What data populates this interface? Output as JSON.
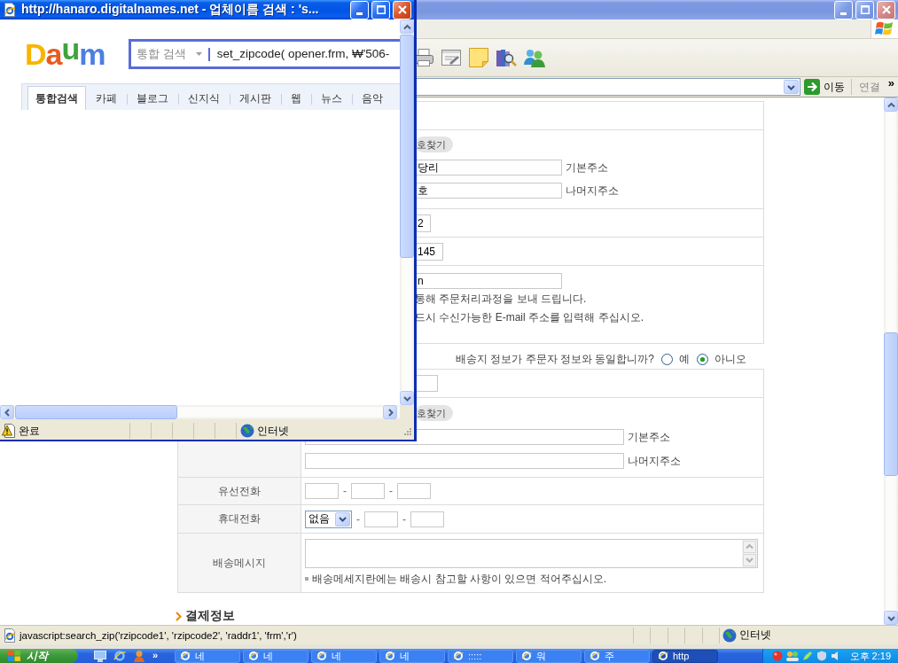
{
  "browser_window": {
    "active": false,
    "address_bar": {
      "go_button": "이동",
      "links": "연결",
      "more": "»"
    },
    "orderer_form": {
      "zip_button": "호찾기",
      "address_fields": [
        {
          "value": "당리",
          "label": "기본주소"
        },
        {
          "value": "호",
          "label": "나머지주소"
        }
      ],
      "phone_value": "2",
      "mobile_value": "145",
      "email_value": "n",
      "email_notes": [
        "통해 주문처리과정을 보내 드립니다.",
        "드시 수신가능한 E-mail 주소를 입력해 주십시오."
      ]
    },
    "same_as_orderer": {
      "question": "배송지 정보가 주문자 정보와 동일합니까?",
      "options": [
        {
          "label": "예",
          "selected": false
        },
        {
          "label": "아니오",
          "selected": true
        }
      ]
    },
    "delivery_form": {
      "zip_button": "호찾기",
      "address_fields": [
        {
          "label": "기본주소"
        },
        {
          "label": "나머지주소"
        }
      ],
      "rows": [
        {
          "label": "유선전화",
          "parts": [
            {
              "kind": "field"
            },
            {
              "kind": "dash",
              "text": "-"
            },
            {
              "kind": "field"
            },
            {
              "kind": "dash",
              "text": "-"
            },
            {
              "kind": "field"
            }
          ]
        },
        {
          "label": "휴대전화",
          "parts": [
            {
              "kind": "select",
              "value": "없음"
            },
            {
              "kind": "dash",
              "text": "-"
            },
            {
              "kind": "field"
            },
            {
              "kind": "dash",
              "text": "-"
            },
            {
              "kind": "field"
            }
          ]
        },
        {
          "label": "배송메시지",
          "parts": [
            {
              "kind": "textarea"
            },
            {
              "kind": "note",
              "text": "배송메세지란에는 배송시 참고할 사항이 있으면 적어주십시오."
            }
          ]
        }
      ]
    },
    "payment_heading": "결제정보",
    "status_bar": {
      "text": "javascript:search_zip('rzipcode1', 'rzipcode2', 'raddr1', 'frm','r')",
      "zone": "인터넷"
    }
  },
  "popup_window": {
    "active": true,
    "title": "http://hanaro.digitalnames.net - 업체이름 검색 : 's...",
    "logo": "Daum",
    "search": {
      "scope": "통합 검색",
      "value": "set_zipcode( opener.frm, ₩'506-"
    },
    "tabs": [
      {
        "label": "통합검색",
        "selected": true
      },
      {
        "label": "카페",
        "selected": false
      },
      {
        "label": "블로그",
        "selected": false
      },
      {
        "label": "신지식",
        "selected": false
      },
      {
        "label": "게시판",
        "selected": false
      },
      {
        "label": "웹",
        "selected": false
      },
      {
        "label": "뉴스",
        "selected": false
      },
      {
        "label": "음악",
        "selected": false
      }
    ],
    "status_bar": {
      "status": "완료",
      "zone": "인터넷"
    }
  },
  "taskbar": {
    "start": "시작",
    "more": "»",
    "tasks": [
      {
        "label": "네",
        "selected": false
      },
      {
        "label": "네",
        "selected": false
      },
      {
        "label": "네",
        "selected": false
      },
      {
        "label": "네",
        "selected": false
      },
      {
        "label": ":::::",
        "selected": false
      },
      {
        "label": "워",
        "selected": false
      },
      {
        "label": "주",
        "selected": false
      },
      {
        "label": "http",
        "selected": true
      }
    ],
    "clock": "오후 2:19"
  }
}
